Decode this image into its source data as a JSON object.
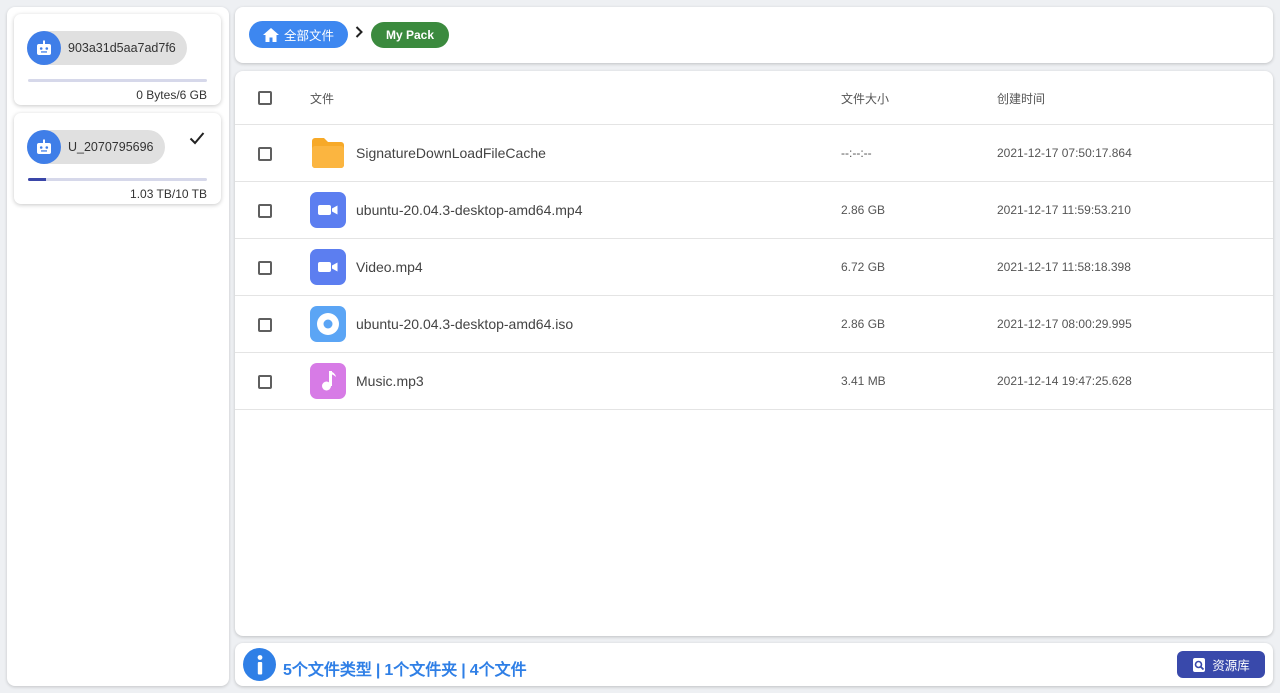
{
  "sidebar": {
    "accounts": [
      {
        "name": "903a31d5aa7ad7f6",
        "quota_label": "0 Bytes/6 GB",
        "used_fraction": 0.0,
        "selected": false
      },
      {
        "name": "U_2070795696",
        "quota_label": "1.03 TB/10 TB",
        "used_fraction": 0.103,
        "selected": true
      }
    ]
  },
  "breadcrumb": {
    "home_label": "全部文件",
    "current_label": "My Pack"
  },
  "table": {
    "headers": {
      "name": "文件",
      "size": "文件大小",
      "created": "创建时间"
    },
    "rows": [
      {
        "name": "SignatureDownLoadFileCache",
        "size": "--:--:--",
        "created": "2021-12-17 07:50:17.864",
        "icon": "folder-icon"
      },
      {
        "name": "ubuntu-20.04.3-desktop-amd64.mp4",
        "size": "2.86 GB",
        "created": "2021-12-17 11:59:53.210",
        "icon": "video-icon"
      },
      {
        "name": "Video.mp4",
        "size": "6.72 GB",
        "created": "2021-12-17 11:58:18.398",
        "icon": "video-icon"
      },
      {
        "name": "ubuntu-20.04.3-desktop-amd64.iso",
        "size": "2.86 GB",
        "created": "2021-12-17 08:00:29.995",
        "icon": "disc-icon"
      },
      {
        "name": "Music.mp3",
        "size": "3.41 MB",
        "created": "2021-12-14 19:47:25.628",
        "icon": "music-icon"
      }
    ]
  },
  "footer": {
    "types_label": "5个文件类型",
    "folders_label": "1个文件夹",
    "files_label": "4个文件",
    "separator": "|",
    "library_button": "资源库"
  },
  "colors": {
    "accent": "#3d87f0",
    "pack": "#3b8a3e",
    "folder": "#fbb540",
    "video": "#5c7ef0",
    "disc": "#5ba5f5",
    "music": "#d77be6",
    "library": "#3949ab"
  }
}
